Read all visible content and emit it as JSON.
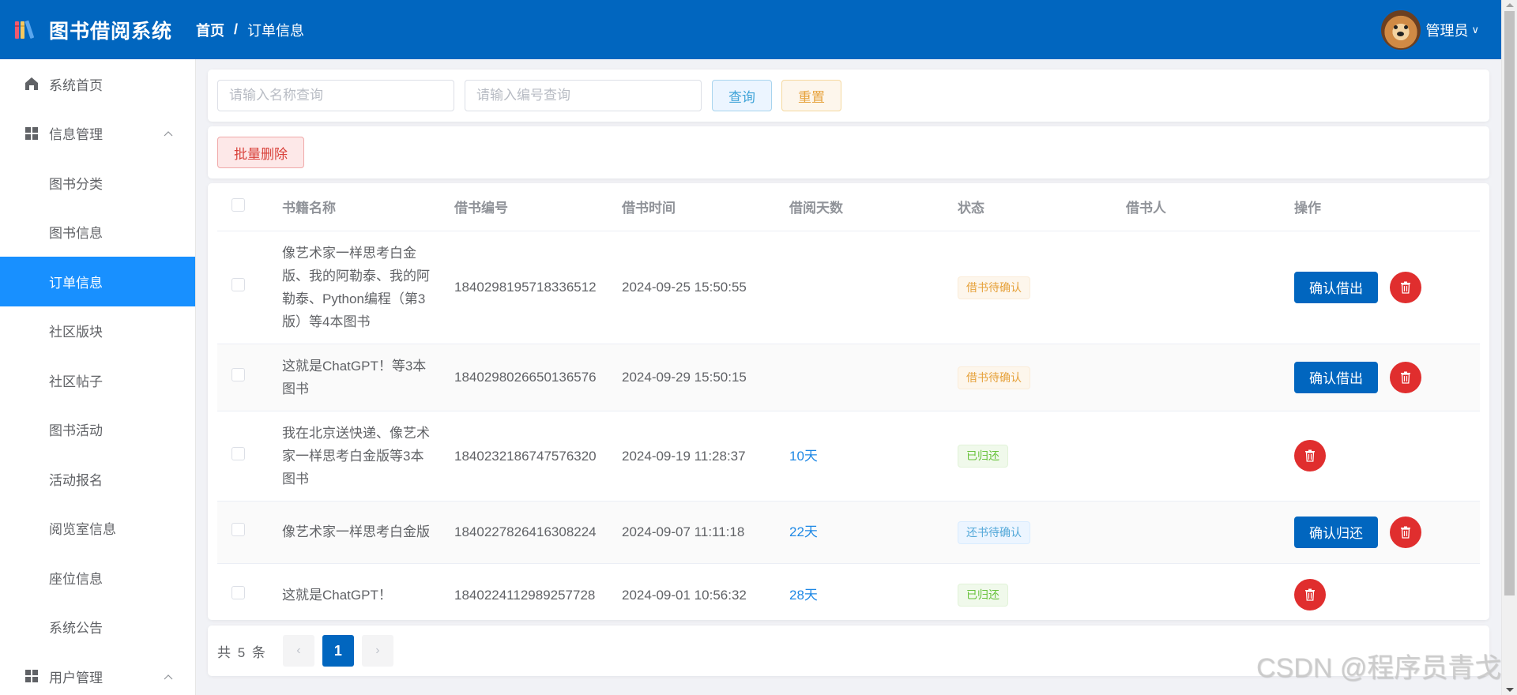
{
  "app": {
    "title": "图书借阅系统",
    "logo_icon": "books-icon"
  },
  "breadcrumb": {
    "home": "首页",
    "separator": "/",
    "current": "订单信息"
  },
  "user": {
    "name": "管理员",
    "caret": "∨"
  },
  "sidebar": {
    "items": [
      {
        "label": "系统首页",
        "icon": "home-icon",
        "level": "top"
      },
      {
        "label": "信息管理",
        "icon": "grid-icon",
        "level": "top",
        "expanded": true,
        "chevron": "^"
      },
      {
        "label": "图书分类",
        "level": "sub"
      },
      {
        "label": "图书信息",
        "level": "sub"
      },
      {
        "label": "订单信息",
        "level": "sub",
        "active": true
      },
      {
        "label": "社区版块",
        "level": "sub"
      },
      {
        "label": "社区帖子",
        "level": "sub"
      },
      {
        "label": "图书活动",
        "level": "sub"
      },
      {
        "label": "活动报名",
        "level": "sub"
      },
      {
        "label": "阅览室信息",
        "level": "sub"
      },
      {
        "label": "座位信息",
        "level": "sub"
      },
      {
        "label": "系统公告",
        "level": "sub"
      },
      {
        "label": "用户管理",
        "icon": "grid-icon",
        "level": "top",
        "expanded": true,
        "chevron": "^"
      }
    ]
  },
  "search": {
    "name_placeholder": "请输入名称查询",
    "name_value": "",
    "number_placeholder": "请输入编号查询",
    "number_value": "",
    "query_label": "查询",
    "reset_label": "重置"
  },
  "toolbar": {
    "batch_delete_label": "批量删除"
  },
  "table": {
    "columns": [
      "书籍名称",
      "借书编号",
      "借书时间",
      "借阅天数",
      "状态",
      "借书人",
      "操作"
    ],
    "rows": [
      {
        "name": "像艺术家一样思考白金版、我的阿勒泰、我的阿勒泰、Python编程（第3版）等4本图书",
        "no": "1840298195718336512",
        "time": "2024-09-25 15:50:55",
        "days": "",
        "status": "借书待确认",
        "status_type": "pending-borrow",
        "borrower": "",
        "action": "确认借出"
      },
      {
        "name": "这就是ChatGPT！等3本图书",
        "no": "1840298026650136576",
        "time": "2024-09-29 15:50:15",
        "days": "",
        "status": "借书待确认",
        "status_type": "pending-borrow",
        "borrower": "",
        "action": "确认借出"
      },
      {
        "name": "我在北京送快递、像艺术家一样思考白金版等3本图书",
        "no": "1840232186747576320",
        "time": "2024-09-19 11:28:37",
        "days": "10天",
        "status": "已归还",
        "status_type": "returned",
        "borrower": "",
        "action": ""
      },
      {
        "name": "像艺术家一样思考白金版",
        "no": "1840227826416308224",
        "time": "2024-09-07 11:11:18",
        "days": "22天",
        "status": "还书待确认",
        "status_type": "pending-return",
        "borrower": "",
        "action": "确认归还"
      },
      {
        "name": "这就是ChatGPT！",
        "no": "1840224112989257728",
        "time": "2024-09-01 10:56:32",
        "days": "28天",
        "status": "已归还",
        "status_type": "returned",
        "borrower": "",
        "action": ""
      }
    ]
  },
  "pagination": {
    "total_label": "共 5 条",
    "prev": "‹",
    "current_page": "1",
    "next": "›"
  },
  "colors": {
    "primary": "#0166bf",
    "active_menu": "#1890ff",
    "danger": "#e02e2e",
    "warning": "#e6a23c",
    "success": "#67c23a"
  },
  "watermark": "CSDN @程序员青戈"
}
